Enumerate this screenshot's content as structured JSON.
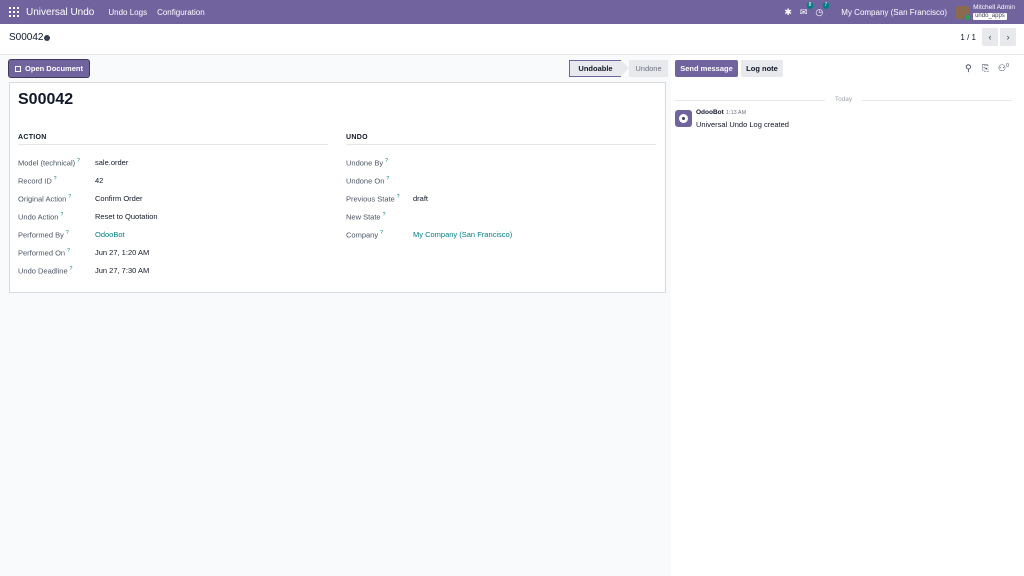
{
  "navbar": {
    "app_name": "Universal Undo",
    "menus": [
      "Undo Logs",
      "Configuration"
    ],
    "messages_badge": "8",
    "activities_badge": "7",
    "company": "My Company (San Francisco)",
    "user_name": "Mitchell Admin",
    "db_name": "undo_apps",
    "icons": [
      "apps-icon",
      "bug-icon",
      "chat-icon",
      "clock-icon"
    ]
  },
  "control_panel": {
    "record_name": "S00042",
    "pager": "1 / 1",
    "prev_label": "‹",
    "next_label": "›"
  },
  "buttons": {
    "open_document": "Open Document"
  },
  "statusbar": {
    "stages": [
      "Undoable",
      "Undone"
    ],
    "active": "Undoable"
  },
  "sheet": {
    "title": "S00042",
    "action_group": {
      "title": "ACTION",
      "fields": [
        {
          "label": "Model (technical)",
          "value": "sale.order",
          "link": false
        },
        {
          "label": "Record ID",
          "value": "42",
          "link": false
        },
        {
          "label": "Original Action",
          "value": "Confirm Order",
          "link": false
        },
        {
          "label": "Undo Action",
          "value": "Reset to Quotation",
          "link": false
        },
        {
          "label": "Performed By",
          "value": "OdooBot",
          "link": true
        },
        {
          "label": "Performed On",
          "value": "Jun 27, 1:20 AM",
          "link": false
        },
        {
          "label": "Undo Deadline",
          "value": "Jun 27, 7:30 AM",
          "link": false
        }
      ]
    },
    "undo_group": {
      "title": "UNDO",
      "fields": [
        {
          "label": "Undone By",
          "value": "",
          "link": false
        },
        {
          "label": "Undone On",
          "value": "",
          "link": false
        },
        {
          "label": "Previous State",
          "value": "draft",
          "link": false
        },
        {
          "label": "New State",
          "value": "",
          "link": false
        },
        {
          "label": "Company",
          "value": "My Company (San Francisco)",
          "link": true
        }
      ]
    }
  },
  "chatter": {
    "send_message": "Send message",
    "log_note": "Log note",
    "followers_count": "0",
    "date_separator": "Today",
    "messages": [
      {
        "author": "OdooBot",
        "time": "1:13 AM",
        "body": "Universal Undo Log created"
      }
    ]
  }
}
